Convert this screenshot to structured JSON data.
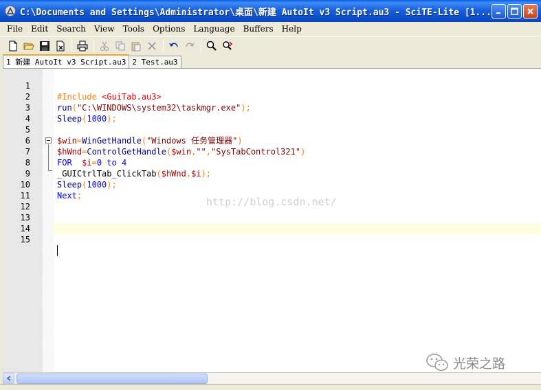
{
  "window": {
    "title": "C:\\Documents and Settings\\Administrator\\桌面\\新建 AutoIt v3 Script.au3 - SciTE-Lite [1..."
  },
  "menu": [
    "File",
    "Edit",
    "Search",
    "View",
    "Tools",
    "Options",
    "Language",
    "Buffers",
    "Help"
  ],
  "tabs": [
    {
      "label": "1 新建 AutoIt v3 Script.au3",
      "active": true
    },
    {
      "label": "2 Test.au3",
      "active": false
    }
  ],
  "editor": {
    "lines": [
      {
        "num": "1"
      },
      {
        "num": "2"
      },
      {
        "num": "3"
      },
      {
        "num": "4"
      },
      {
        "num": "5"
      },
      {
        "num": "6"
      },
      {
        "num": "7"
      },
      {
        "num": "8"
      },
      {
        "num": "9"
      },
      {
        "num": "10"
      },
      {
        "num": "11"
      },
      {
        "num": "12"
      },
      {
        "num": "13"
      },
      {
        "num": "14"
      },
      {
        "num": "15"
      }
    ],
    "code": {
      "l1_directive": "#Include ",
      "l1_file": "<GuiTab.au3>",
      "l2_fn": "run",
      "l2_open": "(",
      "l2_str": "\"C:\\WINDOWS\\system32\\taskmgr.exe\"",
      "l2_close": ");",
      "l3_fn": "Sleep",
      "l3_open": "(",
      "l3_num": "1000",
      "l3_close": ");",
      "l5_var": "$win",
      "l5_eq": "=",
      "l5_fn": "WinGetHandle",
      "l5_open": "(",
      "l5_str": "\"Windows 任务管理器\"",
      "l5_close": ")",
      "l6_var": "$hWnd",
      "l6_eq": "=",
      "l6_fn": "ControlGetHandle",
      "l6_open": "(",
      "l6_arg1": "$win",
      "l6_c1": ",",
      "l6_str1": "\"\"",
      "l6_c2": ",",
      "l6_str2": "\"SysTabControl321\"",
      "l6_close": ")",
      "l7_kw": "FOR",
      "l7_sp": "  ",
      "l7_var": "$i",
      "l7_eq": "=",
      "l7_n1": "0",
      "l7_to": " to ",
      "l7_n2": "4",
      "l8_fn": "_GUICtrlTab_ClickTab",
      "l8_open": "(",
      "l8_a1": "$hWnd",
      "l8_c": ",",
      "l8_a2": "$i",
      "l8_close": ");",
      "l9_fn": "Sleep",
      "l9_open": "(",
      "l9_num": "1000",
      "l9_close": ");",
      "l10_kw": "Next",
      "l10_semi": ";"
    },
    "caret_line": 15
  },
  "watermark": "http://blog.csdn.net/",
  "brand": "光荣之路",
  "colors": {
    "titlebar": "#0c4fcb",
    "caret_line_bg": "#ffffe0",
    "gutter_bg": "#e8e8e8",
    "active_tab_accent": "#f5a623"
  }
}
